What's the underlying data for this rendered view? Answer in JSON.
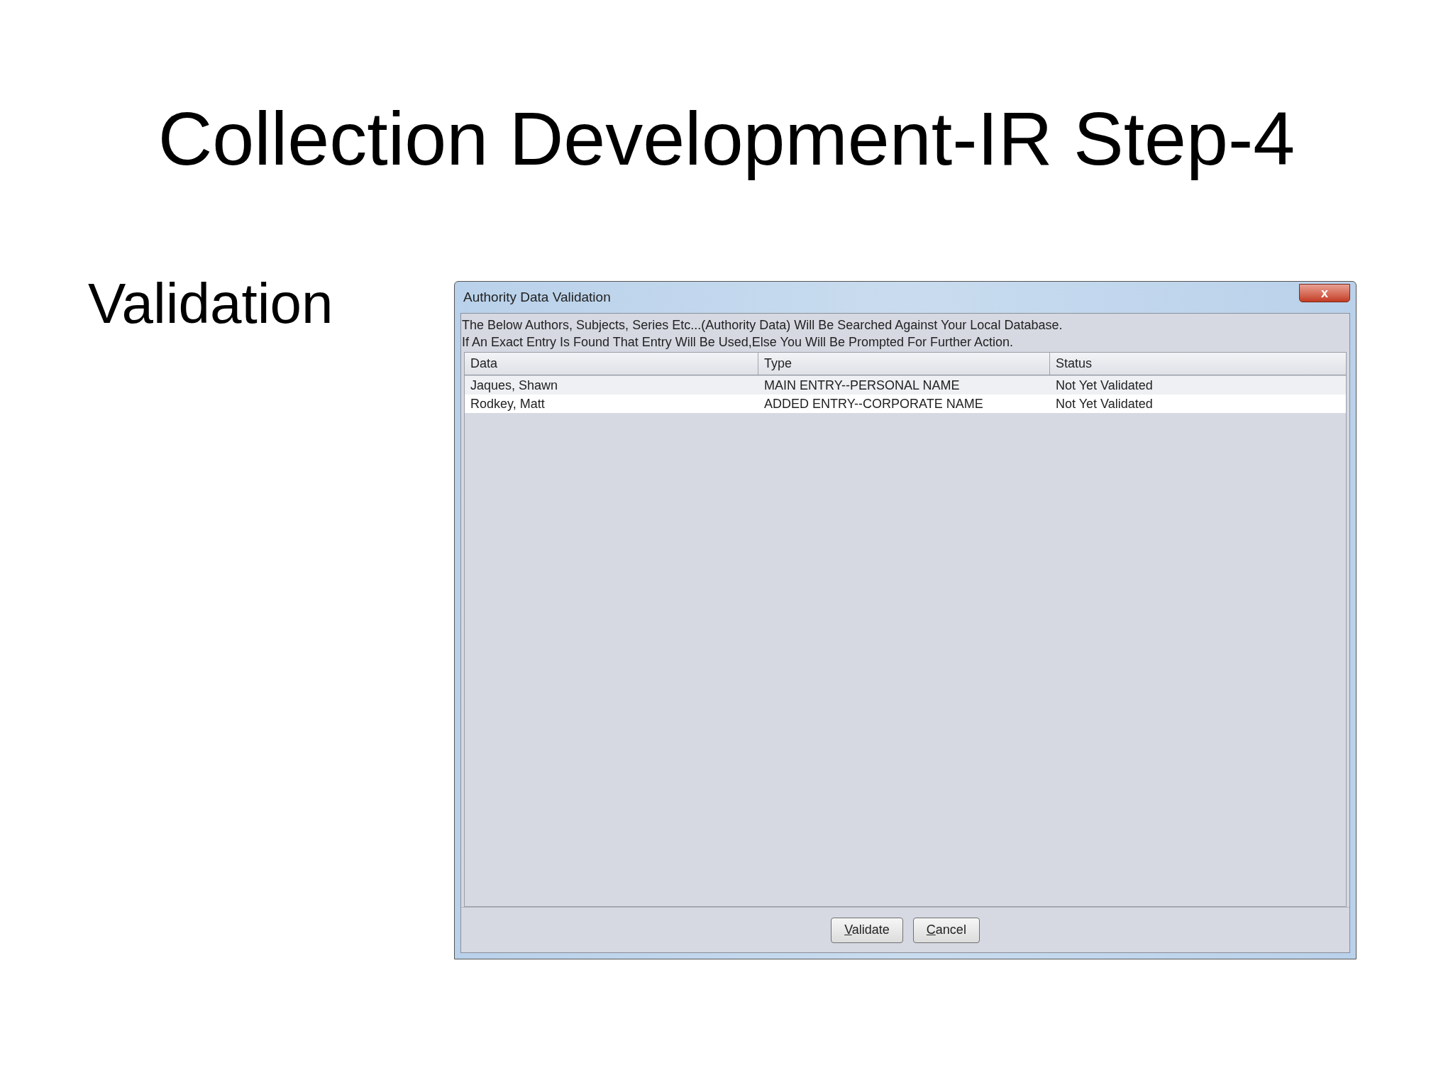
{
  "slide": {
    "title": "Collection Development-IR Step-4",
    "subtitle": "Validation"
  },
  "window": {
    "title": "Authority Data Validation",
    "close": "x"
  },
  "instructions": [
    "The Below Authors, Subjects, Series Etc...(Authority Data) Will Be Searched Against Your Local Database.",
    "If An Exact Entry Is Found That Entry Will Be Used,Else You Will Be Prompted For Further Action."
  ],
  "table": {
    "columns": [
      "Data",
      "Type",
      "Status"
    ],
    "rows": [
      {
        "cells": [
          "Jaques, Shawn",
          "MAIN ENTRY--PERSONAL NAME",
          "Not Yet Validated"
        ]
      },
      {
        "cells": [
          "Rodkey, Matt",
          "ADDED ENTRY--CORPORATE NAME",
          "Not Yet Validated"
        ]
      }
    ]
  },
  "buttons": [
    "Validate",
    "Cancel"
  ]
}
